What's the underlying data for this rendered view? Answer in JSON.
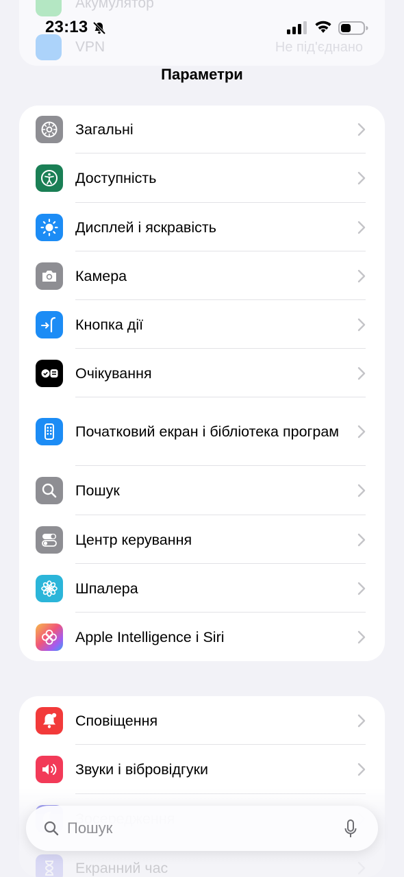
{
  "status_bar": {
    "time": "23:13"
  },
  "ghost": {
    "row1": "Акумулятор",
    "row2": "VPN",
    "row2_value": "Не під'єднано"
  },
  "header": {
    "title": "Параметри"
  },
  "group1": [
    {
      "label": "Загальні",
      "icon": "gear-icon",
      "color": "#8e8e93"
    },
    {
      "label": "Доступність",
      "icon": "accessibility-icon",
      "color": "#1a7f55"
    },
    {
      "label": "Дисплей і яскравість",
      "icon": "sun-icon",
      "color": "#1c8cf5"
    },
    {
      "label": "Камера",
      "icon": "camera-icon",
      "color": "#8e8e93"
    },
    {
      "label": "Кнопка дії",
      "icon": "action-button-icon",
      "color": "#1c8cf5"
    },
    {
      "label": "Очікування",
      "icon": "standby-icon",
      "color": "#000000"
    },
    {
      "label": "Початковий екран і бібліотека програм",
      "icon": "home-screen-icon",
      "color": "#1c8cf5"
    },
    {
      "label": "Пошук",
      "icon": "magnifier-icon",
      "color": "#8e8e93"
    },
    {
      "label": "Центр керування",
      "icon": "toggles-icon",
      "color": "#8e8e93"
    },
    {
      "label": "Шпалера",
      "icon": "flower-icon",
      "color": "#2bb5d9"
    },
    {
      "label": "Apple Intelligence і Siri",
      "icon": "apple-intelligence-icon",
      "color": "#f5a44b"
    }
  ],
  "group2": [
    {
      "label": "Сповіщення",
      "icon": "bell-icon",
      "color": "#f23a3a"
    },
    {
      "label": "Звуки і вібровідгуки",
      "icon": "speaker-icon",
      "color": "#f23a58"
    },
    {
      "label": "Зосередження",
      "icon": "moon-icon",
      "color": "#5e5ce6"
    },
    {
      "label": "Екранний час",
      "icon": "hourglass-icon",
      "color": "#5e5ce6"
    }
  ],
  "search": {
    "placeholder": "Пошук"
  },
  "highlight_color": "#7fd84c"
}
